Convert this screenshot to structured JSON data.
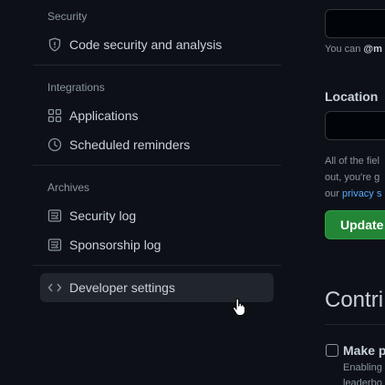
{
  "sidebar": {
    "security": {
      "title": "Security",
      "items": [
        {
          "label": "Code security and analysis",
          "icon": "shield-icon"
        }
      ]
    },
    "integrations": {
      "title": "Integrations",
      "items": [
        {
          "label": "Applications",
          "icon": "apps-grid-icon"
        },
        {
          "label": "Scheduled reminders",
          "icon": "clock-icon"
        }
      ]
    },
    "archives": {
      "title": "Archives",
      "items": [
        {
          "label": "Security log",
          "icon": "log-icon"
        },
        {
          "label": "Sponsorship log",
          "icon": "log-icon"
        }
      ]
    },
    "developer": {
      "label": "Developer settings",
      "icon": "code-icon"
    }
  },
  "main": {
    "top_hint_prefix": "You can ",
    "top_hint_bold": "@m",
    "location_label": "Location",
    "location_value": "",
    "notice_line1": "All of the fiel",
    "notice_line2": "out, you're g",
    "notice_line3_prefix": "our ",
    "notice_link": "privacy s",
    "update_button": "Update",
    "contributions_heading": "Contri",
    "checkbox_label": "Make p",
    "checkbox_desc1": "Enabling",
    "checkbox_desc2": "leaderbo"
  },
  "colors": {
    "background": "#0d1117",
    "accent_green": "#238636",
    "link_blue": "#58a6ff"
  }
}
